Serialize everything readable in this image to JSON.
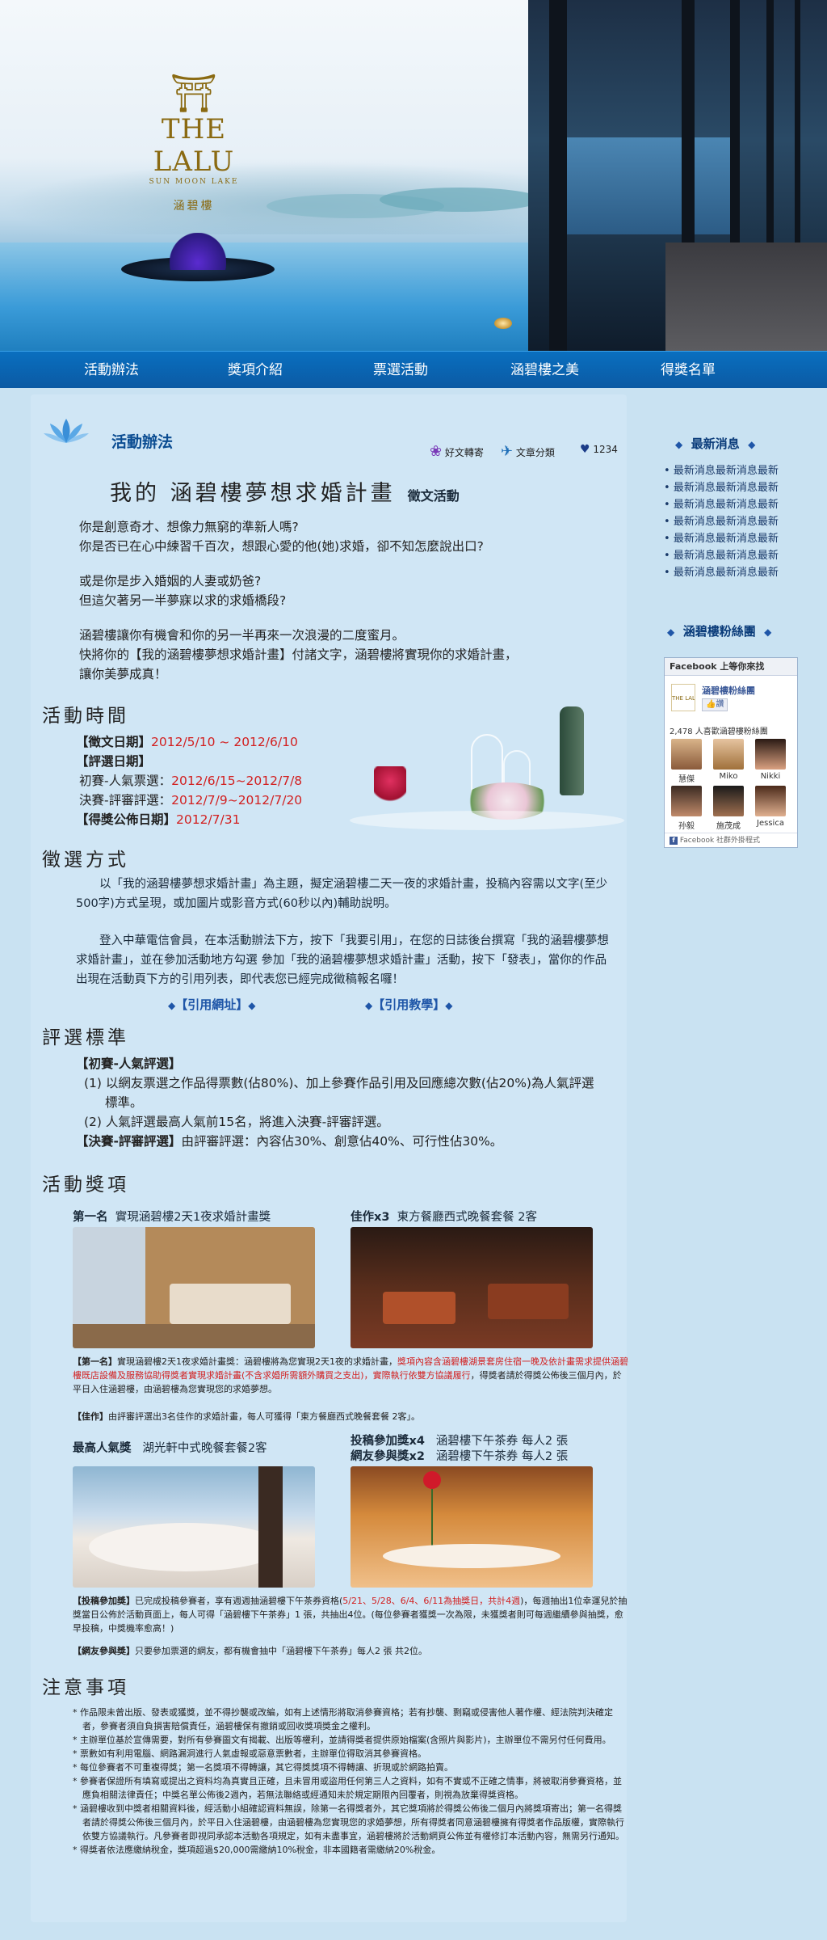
{
  "hero": {
    "logo_cn": "涵碧樓",
    "logo_brand": "THE LALU",
    "logo_sub": "SUN MOON LAKE"
  },
  "nav": [
    "活動辦法",
    "獎項介紹",
    "票選活動",
    "涵碧樓之美",
    "得獎名單"
  ],
  "section": {
    "title": "活動辦法",
    "share": "好文轉寄",
    "category": "文章分類",
    "likes": "1234",
    "headline": "我的 涵碧樓夢想求婚計畫",
    "headline_suffix": "徵文活動"
  },
  "intro": [
    "你是創意奇才、想像力無窮的準新人嗎?",
    "你是否已在心中練習千百次，想跟心愛的他(她)求婚，卻不知怎麼說出口?",
    "或是你是步入婚姻的人妻或奶爸?",
    "但這欠著另一半夢寐以求的求婚橋段?",
    "涵碧樓讓你有機會和你的另一半再來一次浪漫的二度蜜月。",
    "快將你的【我的涵碧樓夢想求婚計畫】付諸文字，涵碧樓將實現你的求婚計畫，",
    "讓你美夢成真！"
  ],
  "schedule": {
    "title": "活動時間",
    "submit_label": "【徵文日期】",
    "submit_date": "2012/5/10 ~ 2012/6/10",
    "review_label": "【評選日期】",
    "prelim_label": "初賽-人氣票選：",
    "prelim_date": "2012/6/15~2012/7/8",
    "final_label": "決賽-評審評選：",
    "final_date": "2012/7/9~2012/7/20",
    "announce_label": "【得獎公佈日期】",
    "announce_date": "2012/7/31"
  },
  "method": {
    "title": "徵選方式",
    "para1": "以「我的涵碧樓夢想求婚計畫」為主題，擬定涵碧樓二天一夜的求婚計畫，投稿內容需以文字(至少500字)方式呈現，或加圖片或影音方式(60秒以內)輔助說明。",
    "para2": "登入中華電信會員，在本活動辦法下方，按下「我要引用」，在您的日誌後台撰寫「我的涵碧樓夢想求婚計畫」，並在參加活動地方勾選 參加「我的涵碧樓夢想求婚計畫」活動，按下「發表」，當你的作品出現在活動頁下方的引用列表，即代表您已經完成徵稿報名囉！",
    "link1": "【引用網址】",
    "link2": "【引用教學】"
  },
  "criteria": {
    "title": "評選標準",
    "prelim_head": "【初賽-人氣評選】",
    "item1": "(1) 以網友票選之作品得票數(佔80%)、加上參賽作品引用及回應總次數(佔20%)為人氣評選標準。",
    "item2": "(2) 人氣評選最高人氣前15名，將進入決賽-評審評選。",
    "final_head": "【決賽-評審評選】",
    "final_text": "由評審評選：內容佔30%、創意佔40%、可行性佔30%。"
  },
  "prizes": {
    "title": "活動獎項",
    "first_rank": "第一名",
    "first_name": "實現涵碧樓2天1夜求婚計畫獎",
    "merit_rank": "佳作x3",
    "merit_name": "東方餐廳西式晚餐套餐 2客",
    "first_desc_a": "【第一名】",
    "first_desc_b": "實現涵碧樓2天1夜求婚計畫獎：涵碧樓將為您實現2天1夜的求婚計畫，",
    "first_desc_red": "獎項內容含涵碧樓湖景套房住宿一晚及依計畫需求提供涵碧樓既店設備及服務協助得獎者實現求婚計畫(不含求婚所需額外購買之支出)，實際執行依雙方協議履行",
    "first_desc_c": "，得獎者請於得獎公佈後三個月內，於平日入住涵碧樓，由涵碧樓為您實現您的求婚夢想。",
    "merit_desc_a": "【佳作】",
    "merit_desc_b": "由評審評選出3名佳作的求婚計畫，每人可獲得「東方餐廳西式晚餐套餐 2客」。",
    "popular_rank": "最高人氣獎",
    "popular_name": "湖光軒中式晚餐套餐2客",
    "submit_rank": "投稿參加獎x4",
    "submit_name": "涵碧樓下午茶券 每人2 張",
    "voter_rank": "網友參與獎x2",
    "voter_name": "涵碧樓下午茶券 每人2 張",
    "submit_desc_a": "【投稿參加獎】",
    "submit_desc_b": "已完成投稿參賽者，享有週週抽涵碧樓下午茶券資格(",
    "submit_desc_red": "5/21、5/28、6/4、6/11為抽獎日，共計4週",
    "submit_desc_c": ")，每週抽出1位幸運兒於抽獎當日公佈於活動頁面上，每人可得「涵碧樓下午茶券」1 張，共抽出4位。(每位參賽者獲獎一次為限，未獲獎者則可每週繼續參與抽獎，愈早投稿，中獎機率愈高！)",
    "voter_desc_a": "【網友參與獎】",
    "voter_desc_b": "只要參加票選的網友，都有機會抽中「涵碧樓下午茶券」每人2 張 共2位。"
  },
  "notes": {
    "title": "注意事項",
    "items": [
      "作品限未曾出版、發表或獲獎，並不得抄襲或改編，如有上述情形將取消參賽資格；若有抄襲、剽竊或侵害他人著作權、經法院判決確定者，參賽者須自負損害賠償責任，涵碧樓保有撤銷或回收獎項獎金之權利。",
      "主辦單位基於宣傳需要，對所有參賽圖文有揭載、出版等權利，並請得獎者提供原始檔案(含照片與影片)，主辦單位不需另付任何費用。",
      "票數如有利用電腦、網路漏洞進行人氣虛報或惡意票數者，主辦單位得取消其參賽資格。",
      "每位參賽者不可重複得獎；第一名獎項不得轉讓，其它得獎獎項不得轉讓、折現或於網路拍賣。",
      "參賽者保證所有填寫或提出之資料均為真實且正確，且未冒用或盜用任何第三人之資料，如有不實或不正確之情事，將被取消參賽資格，並應負相關法律責任；中獎名單公佈後2週內，若無法聯絡或經通知未於規定期限內回覆者，則視為放棄得獎資格。",
      "涵碧樓收到中獎者相關資料後，經活動小組確認資料無誤，除第一名得獎者外，其它獎項將於得獎公佈後二個月內將獎項寄出；第一名得獎者請於得獎公佈後三個月內，於平日入住涵碧樓，由涵碧樓為您實現您的求婚夢想，所有得獎者同意涵碧樓擁有得獎者作品版權，實際執行依雙方協議執行。凡參賽者即視同承認本活動各項規定，如有未盡事宜，涵碧樓將於活動網頁公佈並有權修訂本活動內容，無需另行通知。",
      "得獎者依法應繳納稅金，獎項超過$20,000需繳納10%稅金，非本國籍者需繳納20%稅金。"
    ]
  },
  "sidebar": {
    "news_title": "最新消息",
    "news": [
      "最新消息最新消息最新",
      "最新消息最新消息最新",
      "最新消息最新消息最新",
      "最新消息最新消息最新",
      "最新消息最新消息最新",
      "最新消息最新消息最新",
      "最新消息最新消息最新"
    ],
    "fans_title": "涵碧樓粉絲團",
    "fb_header": "Facebook 上等你來找",
    "fb_page": "涵碧樓粉絲團",
    "fb_like": "讚",
    "fb_count": "2,478 人喜歡涵碧樓粉絲團",
    "fb_fans": [
      "慧傑",
      "Miko",
      "Nikki",
      "孙毅",
      "施茂成",
      "Jessica"
    ],
    "fb_footer": "Facebook 社群外掛程式",
    "fb_logo": "THE LALU"
  },
  "colors": {
    "nav": "#0b5aa4",
    "accent": "#1f56a8",
    "red": "#d21f1f",
    "background": "#c9e2f2"
  }
}
